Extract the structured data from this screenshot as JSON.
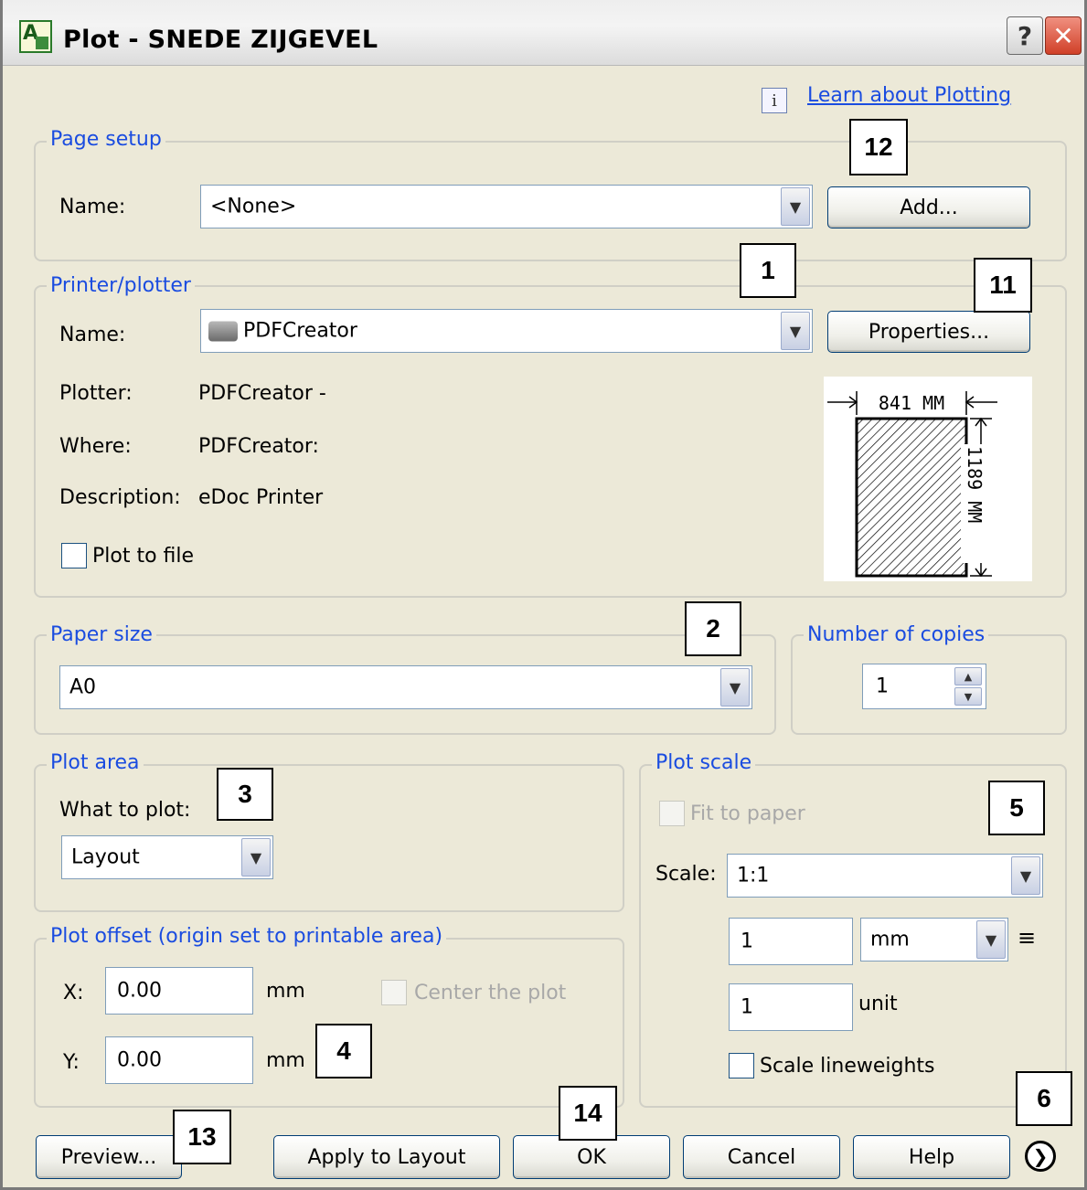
{
  "window": {
    "title": "Plot - SNEDE ZIJGEVEL",
    "help_glyph": "?",
    "close_glyph": "✕"
  },
  "learn_link": "Learn about Plotting",
  "page_setup": {
    "title": "Page setup",
    "name_label": "Name:",
    "name_value": "<None>",
    "add_label": "Add..."
  },
  "printer": {
    "title": "Printer/plotter",
    "name_label": "Name:",
    "name_value": "PDFCreator",
    "properties_label": "Properties...",
    "plotter_label": "Plotter:",
    "plotter_value": "PDFCreator -",
    "where_label": "Where:",
    "where_value": "PDFCreator:",
    "description_label": "Description:",
    "description_value": "eDoc Printer",
    "plot_to_file_label": "Plot to file",
    "plot_to_file_checked": false,
    "paper_width": "841  MM",
    "paper_height": "1189  MM"
  },
  "paper_size": {
    "title": "Paper size",
    "value": "A0"
  },
  "copies": {
    "title": "Number of copies",
    "value": "1"
  },
  "plot_area": {
    "title": "Plot area",
    "what_label": "What to plot:",
    "value": "Layout"
  },
  "plot_offset": {
    "title": "Plot offset (origin set to printable area)",
    "x_label": "X:",
    "x_value": "0.00",
    "x_unit": "mm",
    "y_label": "Y:",
    "y_value": "0.00",
    "y_unit": "mm",
    "center_label": "Center the plot"
  },
  "plot_scale": {
    "title": "Plot scale",
    "fit_label": "Fit to paper",
    "scale_label": "Scale:",
    "scale_value": "1:1",
    "mm_value": "1",
    "mm_unit": "mm",
    "equals": "≡",
    "unit_value": "1",
    "unit_label": "unit",
    "lineweights_label": "Scale lineweights"
  },
  "buttons": {
    "preview": "Preview...",
    "apply": "Apply to Layout",
    "ok": "OK",
    "cancel": "Cancel",
    "help": "Help"
  },
  "callouts": [
    "1",
    "2",
    "3",
    "4",
    "5",
    "6",
    "11",
    "12",
    "13",
    "14"
  ]
}
